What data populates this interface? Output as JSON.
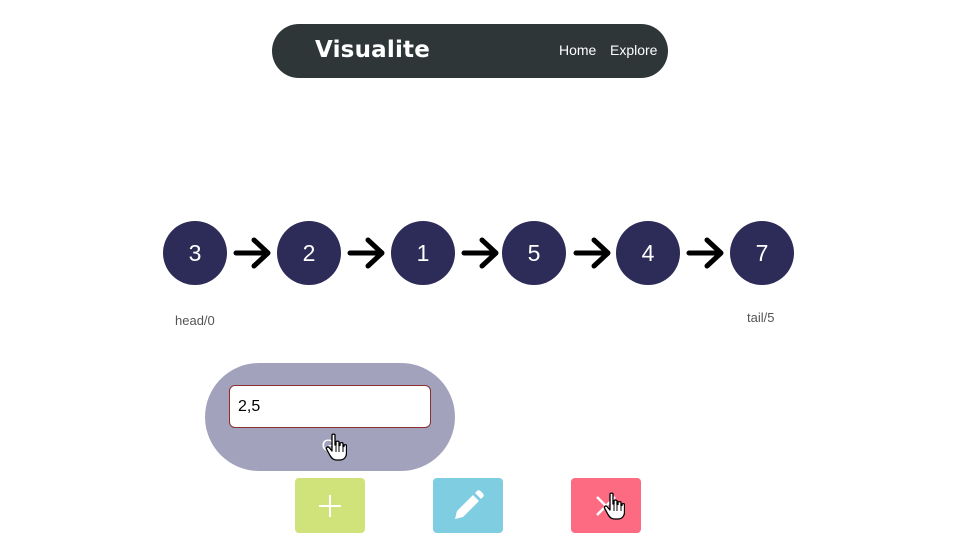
{
  "navbar": {
    "brand": "Visualite",
    "links": [
      "Home",
      "Explore"
    ],
    "background_color": "#2f3638"
  },
  "linked_list": {
    "nodes": [
      "3",
      "2",
      "1",
      "5",
      "4",
      "7"
    ],
    "node_color": "#2d2b58",
    "arrow_icon": "arrow-right-icon",
    "head_label": "head/0",
    "tail_label": "tail/5"
  },
  "controls": {
    "input_value": "2,5",
    "go_label": "Go",
    "panel_color": "#a2a2bd",
    "buttons": [
      {
        "name": "add",
        "icon": "plus-icon",
        "color": "#cfe37a"
      },
      {
        "name": "edit",
        "icon": "pencil-icon",
        "color": "#7fcde0"
      },
      {
        "name": "delete",
        "icon": "close-icon",
        "color": "#fd6b82"
      }
    ]
  }
}
